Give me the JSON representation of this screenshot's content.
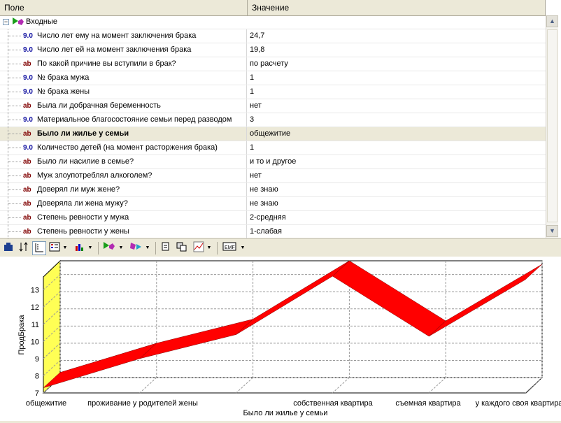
{
  "grid": {
    "col_field": "Поле",
    "col_value": "Значение",
    "group_label": "Входные",
    "rows": [
      {
        "type": "9.0",
        "label": "Число лет ему на момент заключения брака",
        "value": "24,7"
      },
      {
        "type": "9.0",
        "label": "Число лет ей на момент заключения брака",
        "value": "19,8"
      },
      {
        "type": "ab",
        "label": "По какой причине вы вступили в брак?",
        "value": "по расчету"
      },
      {
        "type": "9.0",
        "label": "№ брака мужа",
        "value": "1"
      },
      {
        "type": "9.0",
        "label": "№ брака жены",
        "value": "1"
      },
      {
        "type": "ab",
        "label": "Была ли добрачная беременность",
        "value": "нет"
      },
      {
        "type": "9.0",
        "label": "Материальное благосостояние семьи перед разводом",
        "value": "3"
      },
      {
        "type": "ab",
        "label": "Было ли жилье у семьи",
        "value": "общежитие"
      },
      {
        "type": "9.0",
        "label": "Количество детей (на момент расторжения брака)",
        "value": "1"
      },
      {
        "type": "ab",
        "label": "Было ли насилие в семье?",
        "value": "и то и другое"
      },
      {
        "type": "ab",
        "label": "Муж злоупотреблял алкоголем?",
        "value": "нет"
      },
      {
        "type": "ab",
        "label": "Доверял ли муж жене?",
        "value": "не знаю"
      },
      {
        "type": "ab",
        "label": "Доверяла ли жена мужу?",
        "value": "не знаю"
      },
      {
        "type": "ab",
        "label": "Степень ревности у мужа",
        "value": "2-средняя"
      },
      {
        "type": "ab",
        "label": "Степень ревности у жены",
        "value": "1-слабая"
      }
    ]
  },
  "toolbar": {
    "icons": [
      "run-icon",
      "sort-icon",
      "axis-icon",
      "legend-icon",
      "chart-type-icon",
      "input-node-icon",
      "output-node-icon",
      "copy-icon",
      "compare-icon",
      "line-chart-icon",
      "emf-export-icon"
    ],
    "emf_label": "EMF"
  },
  "chart_data": {
    "type": "line",
    "ylabel": "ПродБрака",
    "xlabel": "Было ли жилье у семьи",
    "categories": [
      "общежитие",
      "проживание у родителей жены",
      "собственная квартира",
      "съемная квартира",
      "у каждого своя квартира"
    ],
    "x_ticks_shown": [
      "общежитие",
      "проживание у родителей жены",
      "",
      "собственная квартира",
      "съемная квартира",
      "у каждого своя квартира"
    ],
    "series": [
      {
        "values": [
          7.3,
          9.0,
          10.4,
          13.8,
          10.3,
          13.6
        ]
      }
    ],
    "yticks": [
      7,
      8,
      9,
      10,
      11,
      12,
      13
    ],
    "ylim": [
      7,
      13.8
    ],
    "color": "#ff0000"
  }
}
